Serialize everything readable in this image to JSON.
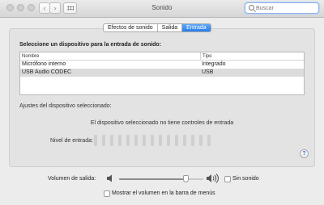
{
  "window": {
    "title": "Sonido",
    "back_glyph": "‹",
    "forward_glyph": "›",
    "show_all_icon": "grid-icon",
    "search_placeholder": "Buscar"
  },
  "tabs": [
    {
      "label": "Efectos de sonido",
      "active": false
    },
    {
      "label": "Salida",
      "active": false
    },
    {
      "label": "Entrada",
      "active": true
    }
  ],
  "input": {
    "heading": "Seleccione un dispositivo para la entrada de sonido:",
    "columns": [
      "Nombre",
      "Tipo"
    ],
    "devices": [
      {
        "name": "Micrófono interno",
        "type": "Integrado",
        "selected": false
      },
      {
        "name": "USB Audio CODEC",
        "type": "USB",
        "selected": true
      }
    ],
    "settings_title": "Ajustes del dispositivo seleccionado:",
    "no_controls_message": "El dispositivo seleccionado no tiene controles de entrada",
    "level_label": "Nivel de entrada:",
    "level_bar_count": 15,
    "level_active_bars": 0
  },
  "help_glyph": "?",
  "output": {
    "volume_label": "Volumen de salida:",
    "volume_fraction": 0.8,
    "mute_label": "Sin sonido",
    "mute_checked": false,
    "show_in_menu_label": "Mostrar el volumen en la barra de menús",
    "show_in_menu_checked": false
  },
  "colors": {
    "accent": "#2a7de9",
    "selected_row": "#dcdcdc",
    "window_bg": "#ececec"
  }
}
